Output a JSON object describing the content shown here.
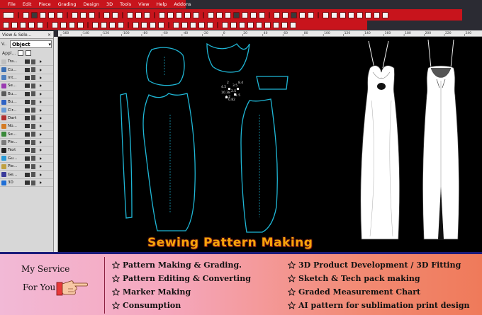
{
  "menu": [
    "File",
    "Edit",
    "Piece",
    "Grading",
    "Design",
    "3D",
    "Tools",
    "View",
    "Help",
    "Addons"
  ],
  "left_panel": {
    "title": "View & Sele...",
    "close": "×",
    "select_prefix": "V..",
    "select_value": "Object",
    "apply_label": "Appl...",
    "items": [
      {
        "label": "Tra...",
        "color": "#c0c0c0"
      },
      {
        "label": "Co...",
        "color": "#3a6fb4"
      },
      {
        "label": "Int...",
        "color": "#4e7fbf"
      },
      {
        "label": "Se...",
        "color": "#9a3ab0"
      },
      {
        "label": "Bu...",
        "color": "#5a5a5a"
      },
      {
        "label": "Bu...",
        "color": "#2f63c4"
      },
      {
        "label": "Cir...",
        "color": "#6a9bd6"
      },
      {
        "label": "Dart",
        "color": "#b03030"
      },
      {
        "label": "No...",
        "color": "#d47b24"
      },
      {
        "label": "Se...",
        "color": "#3a8a3a"
      },
      {
        "label": "Ple...",
        "color": "#7a7a7a"
      },
      {
        "label": "Text",
        "color": "#222222"
      },
      {
        "label": "Gu...",
        "color": "#2b9ad6"
      },
      {
        "label": "Pie...",
        "color": "#c0a040"
      },
      {
        "label": "Ge...",
        "color": "#3a3a9a"
      },
      {
        "label": "3D",
        "color": "#1f6fd6"
      }
    ]
  },
  "ruler_ticks": [
    "-160",
    "-140",
    "-120",
    "-100",
    "-80",
    "-60",
    "-40",
    "-20",
    "0",
    "20",
    "40",
    "60",
    "80",
    "100",
    "120",
    "140",
    "160",
    "180",
    "200",
    "220",
    "240"
  ],
  "canvas": {
    "title": "Sewing Pattern Making",
    "measure_labels": [
      "2",
      "3.5",
      "8.4",
      "4.5",
      "10.38",
      "2.5",
      "1.2",
      "0.82",
      "1.5"
    ]
  },
  "banner": {
    "heading_line1": "My Service",
    "heading_line2": "For You",
    "services_left": [
      "Pattern Making & Grading.",
      "Pattern Editing & Converting",
      "Marker Making",
      "Consumption"
    ],
    "services_right": [
      "3D Product Development / 3D Fitting",
      "Sketch & Tech pack making",
      "Graded Measurement Chart",
      "AI pattern for sublimation print design"
    ]
  },
  "colors": {
    "accent_red": "#c8141c",
    "pattern_line": "#1fb7d6",
    "title_orange": "#f5a40a",
    "banner_border": "#1b1b7a"
  },
  "icons": {
    "hand": "pointing-hand-icon",
    "bullet": "star-outline-icon"
  }
}
